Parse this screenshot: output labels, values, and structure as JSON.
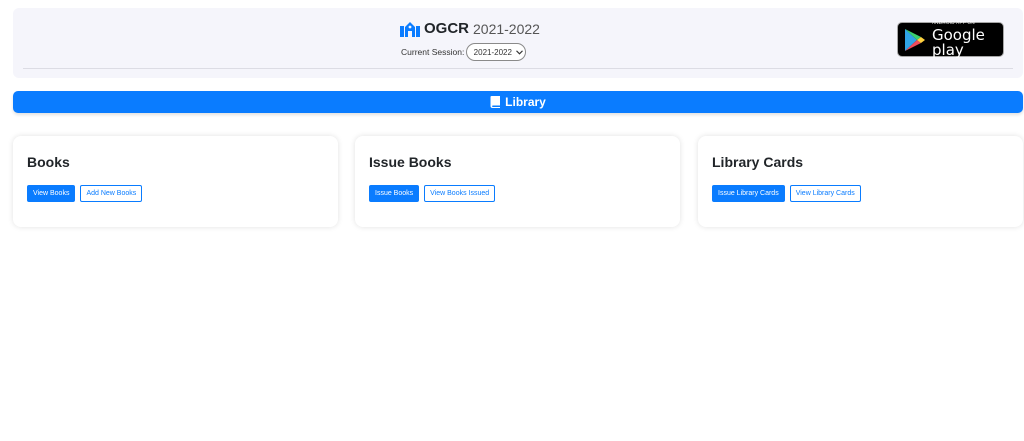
{
  "header": {
    "brand_name": "OGCR",
    "brand_year": "2021-2022",
    "session_label": "Current Session:",
    "session_value": "2021-2022",
    "play_badge_small": "ANDROID APP ON",
    "play_badge_big": "Google play"
  },
  "library_bar": {
    "label": "Library"
  },
  "cards": [
    {
      "title": "Books",
      "buttons": [
        "View Books",
        "Add New Books"
      ]
    },
    {
      "title": "Issue Books",
      "buttons": [
        "Issue Books",
        "View Books Issued"
      ]
    },
    {
      "title": "Library Cards",
      "buttons": [
        "Issue Library Cards",
        "View Library Cards"
      ]
    }
  ],
  "colors": {
    "primary": "#0a7cff",
    "header_bg": "#f5f5fb"
  }
}
